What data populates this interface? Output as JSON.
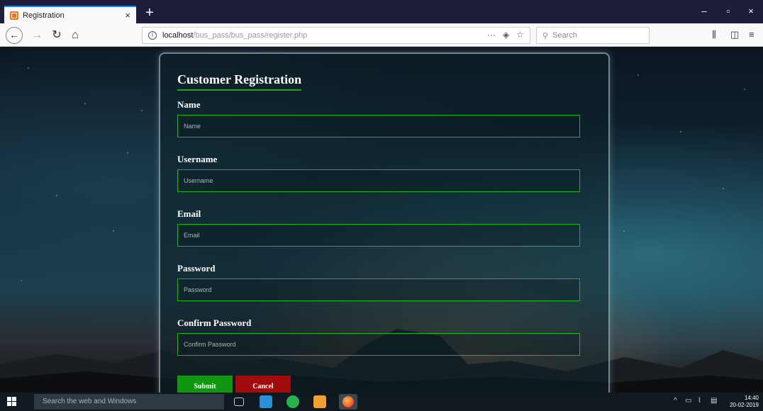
{
  "browser": {
    "tab_title": "Registration",
    "tab_close": "×",
    "new_tab": "+",
    "url_host": "localhost",
    "url_path": "/bus_pass/bus_pass/register.php",
    "url_more": "···",
    "search_placeholder": "Search",
    "window_controls": [
      "–",
      "▫",
      "×"
    ]
  },
  "form": {
    "title": "Customer Registration",
    "fields": [
      {
        "label": "Name",
        "placeholder": "Name"
      },
      {
        "label": "Username",
        "placeholder": "Username"
      },
      {
        "label": "Email",
        "placeholder": "Email"
      },
      {
        "label": "Password",
        "placeholder": "Password"
      },
      {
        "label": "Confirm Password",
        "placeholder": "Confirm Password"
      }
    ],
    "submit_label": "Submit",
    "cancel_label": "Cancel"
  },
  "taskbar": {
    "search_placeholder": "Search the web and Windows",
    "time": "14:40",
    "date": "20-02-2019"
  },
  "colors": {
    "accent_green": "#17b717",
    "submit_bg": "#129612",
    "cancel_bg": "#a00b0b"
  }
}
